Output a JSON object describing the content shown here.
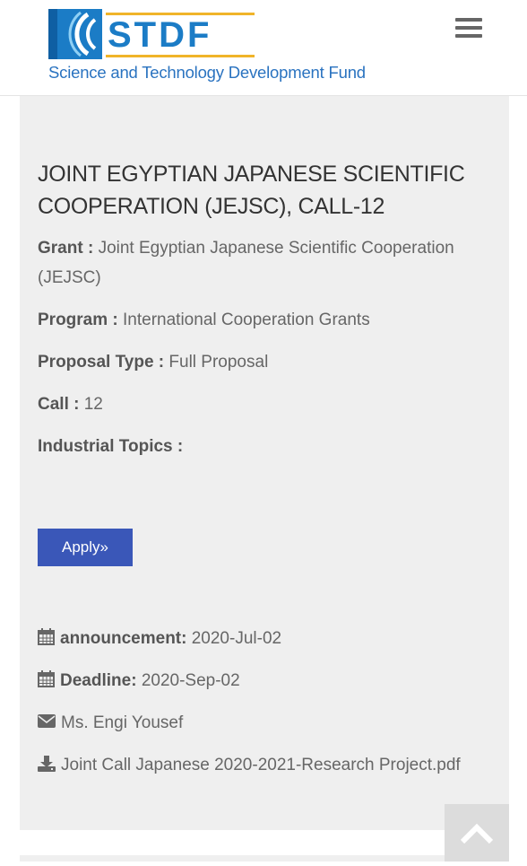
{
  "header": {
    "logo_text": "STDF",
    "logo_tagline": "Science and Technology Development Fund",
    "menu_icon": "hamburger-menu-icon"
  },
  "call": {
    "title": "JOINT EGYPTIAN JAPANESE SCIENTIFIC COOPERATION (JEJSC), CALL-12",
    "grant_label": "Grant :",
    "grant_value": "Joint Egyptian Japanese Scientific Cooperation (JEJSC)",
    "program_label": "Program :",
    "program_value": "International Cooperation Grants",
    "proposal_type_label": "Proposal Type :",
    "proposal_type_value": "Full Proposal",
    "call_label": "Call :",
    "call_value": "12",
    "industrial_topics_label": "Industrial Topics :",
    "industrial_topics_value": "",
    "apply_label": "Apply»"
  },
  "meta": {
    "announcement_label": "announcement:",
    "announcement_value": "2020-Jul-02",
    "deadline_label": "Deadline:",
    "deadline_value": "2020-Sep-02",
    "contact": "Ms. Engi Yousef",
    "attachment": "Joint Call Japanese 2020-2021-Research Project.pdf"
  },
  "icons": {
    "calendar": "calendar-icon",
    "envelope": "envelope-icon",
    "download": "download-icon",
    "scroll_top": "chevron-up-icon"
  },
  "colors": {
    "brand_blue": "#1b7cc6",
    "brand_gold": "#f0b429",
    "apply_button": "#3a57b8",
    "card_background": "#efefef"
  }
}
